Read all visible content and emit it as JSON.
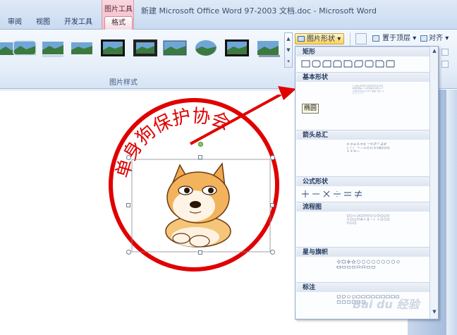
{
  "window": {
    "title": "新建 Microsoft Office Word 97-2003 文档.doc - Microsoft Word"
  },
  "tabs": {
    "review": "审阅",
    "view": "视图",
    "developer": "开发工具",
    "context_group": "图片工具",
    "format": "格式"
  },
  "ribbon": {
    "picture_styles_group": "图片样式",
    "picture_shape_button": "图片形状",
    "bring_to_front_button": "置于顶层",
    "align_button": "对齐",
    "style_count": 9
  },
  "shapes_menu": {
    "sections": {
      "rectangles": "矩形",
      "basic_shapes": "基本形状",
      "block_arrows": "箭头总汇",
      "equation_shapes": "公式形状",
      "flowchart": "流程图",
      "stars_banners": "星与旗帜",
      "callouts": "标注"
    },
    "tooltip": "椭圆"
  },
  "document": {
    "stamp_text": "单身狗保护协会",
    "icon": "doge-sticker-image"
  },
  "watermark": "Bai du 经验",
  "colors": {
    "stamp_red": "#e00000",
    "context_tab": "#f0b9c6",
    "ribbon_blue": "#dbe6f4"
  }
}
